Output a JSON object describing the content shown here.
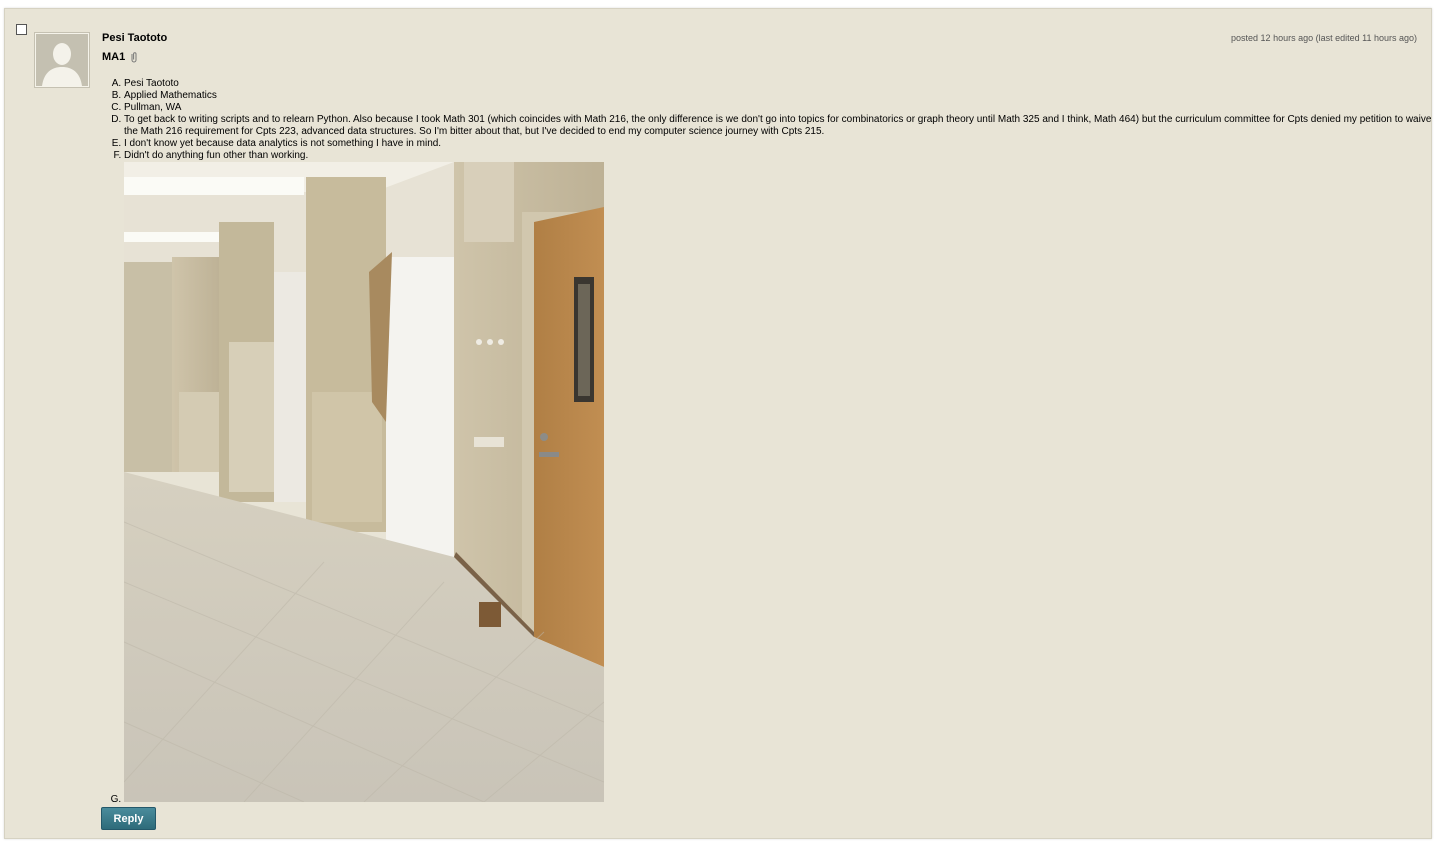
{
  "post": {
    "author": "Pesi Taototo",
    "title": "MA1",
    "meta": "posted 12 hours ago (last edited 11 hours ago)",
    "answers": [
      "Pesi Taototo",
      "Applied Mathematics",
      "Pullman, WA",
      "To get back to writing scripts and to relearn Python. Also because I took Math 301 (which coincides with Math 216, the only difference is we don't go into topics for combinatorics or graph theory until Math 325 and I think, Math 464) but the curriculum committee for Cpts denied my petition to waive the Math 216 requirement for Cpts 223, advanced data structures. So I'm bitter about that, but I've decided to end my computer science journey with Cpts 215.",
      "I don't know yet because data analytics is not something I have in mind.",
      "Didn't do anything fun other than working."
    ],
    "reply_label": "Reply"
  },
  "icons": {
    "avatar": "default-user-avatar",
    "attachment": "paperclip-icon"
  },
  "colors": {
    "panel_bg": "#e8e4d6",
    "reply_button": "#3a7a8a"
  }
}
